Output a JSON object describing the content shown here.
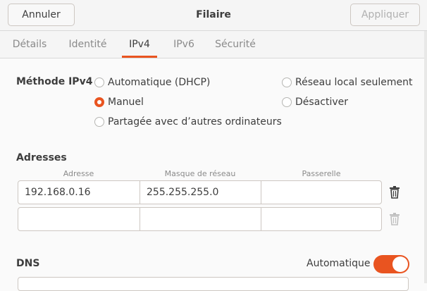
{
  "header": {
    "cancel_label": "Annuler",
    "title": "Filaire",
    "apply_label": "Appliquer"
  },
  "tabs": [
    {
      "label": "Détails",
      "active": false
    },
    {
      "label": "Identité",
      "active": false
    },
    {
      "label": "IPv4",
      "active": true
    },
    {
      "label": "IPv6",
      "active": false
    },
    {
      "label": "Sécurité",
      "active": false
    }
  ],
  "method": {
    "label": "Méthode IPv4",
    "options": [
      {
        "label": "Automatique (DHCP)",
        "checked": false
      },
      {
        "label": "Réseau local seulement",
        "checked": false
      },
      {
        "label": "Manuel",
        "checked": true
      },
      {
        "label": "Désactiver",
        "checked": false
      },
      {
        "label": "Partagée avec d’autres ordinateurs",
        "checked": false
      }
    ]
  },
  "addresses": {
    "title": "Adresses",
    "headers": [
      "Adresse",
      "Masque de réseau",
      "Passerelle"
    ],
    "rows": [
      {
        "address": "192.168.0.16",
        "netmask": "255.255.255.0",
        "gateway": ""
      },
      {
        "address": "",
        "netmask": "",
        "gateway": ""
      }
    ]
  },
  "dns": {
    "title": "DNS",
    "auto_label": "Automatique",
    "auto_enabled": true
  },
  "colors": {
    "accent": "#e95420"
  },
  "icons": {
    "delete": "trash-icon"
  }
}
